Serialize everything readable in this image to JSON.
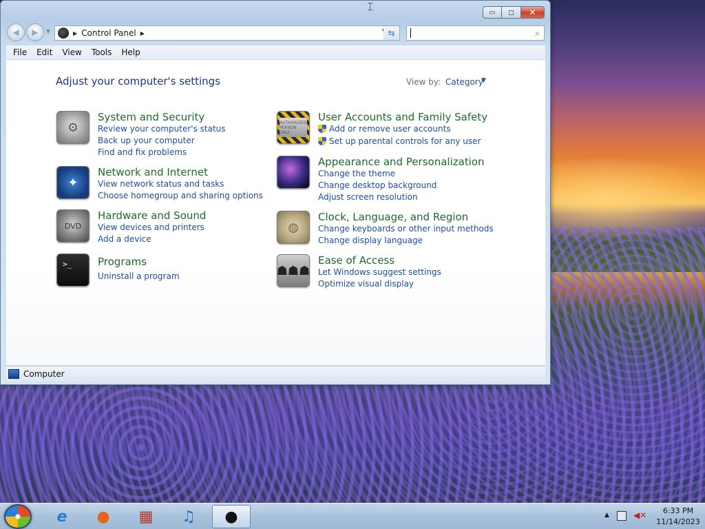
{
  "window": {
    "controls": {
      "minimize": "▭",
      "maximize": "◻",
      "close": "✕"
    }
  },
  "navbar": {
    "back_icon": "◀",
    "forward_icon": "▶",
    "address_text": "Control Panel",
    "search_placeholder": ""
  },
  "menu": [
    "File",
    "Edit",
    "View",
    "Tools",
    "Help"
  ],
  "content": {
    "title": "Adjust your computer's settings",
    "view_by_label": "View by:",
    "view_by_value": "Category",
    "categories": [
      {
        "title": "System and Security",
        "icon": "vault-icon",
        "links": [
          "Review your computer's status",
          "Back up your computer",
          "Find and fix problems"
        ]
      },
      {
        "title": "Network and Internet",
        "icon": "compass-icon",
        "links": [
          "View network status and tasks",
          "Choose homegroup and sharing options"
        ]
      },
      {
        "title": "Hardware and Sound",
        "icon": "dvd-icon",
        "icon_text": "DVD",
        "links": [
          "View devices and printers",
          "Add a device"
        ]
      },
      {
        "title": "Programs",
        "icon": "terminal-icon",
        "icon_text": ">_",
        "links": [
          "Uninstall a program"
        ]
      },
      {
        "title": "User Accounts and Family Safety",
        "icon": "id-card-icon",
        "icon_text": "AUTHORIZED PERSON ONLY",
        "links": [
          "Add or remove user accounts",
          "Set up parental controls for any user"
        ]
      },
      {
        "title": "Appearance and Personalization",
        "icon": "wallpaper-icon",
        "links": [
          "Change the theme",
          "Change desktop background",
          "Adjust screen resolution"
        ]
      },
      {
        "title": "Clock, Language, and Region",
        "icon": "map-icon",
        "links": [
          "Change keyboards or other input methods",
          "Change display language"
        ]
      },
      {
        "title": "Ease of Access",
        "icon": "people-icon",
        "links": [
          "Let Windows suggest settings",
          "Optimize visual display"
        ]
      }
    ]
  },
  "statusbar": {
    "text": "Computer"
  },
  "taskbar": {
    "apps": [
      {
        "name": "internet-explorer-icon",
        "glyph": "e"
      },
      {
        "name": "firefox-icon",
        "glyph": "●"
      },
      {
        "name": "store-icon",
        "glyph": "▦"
      },
      {
        "name": "music-icon",
        "glyph": "♫"
      },
      {
        "name": "control-panel-icon",
        "glyph": "●"
      }
    ],
    "time": "6:33 PM",
    "date": "11/14/2023"
  },
  "colors": {
    "category_title": "#1e6a2e",
    "link": "#1c4ea1",
    "page_title": "#1e3287"
  }
}
